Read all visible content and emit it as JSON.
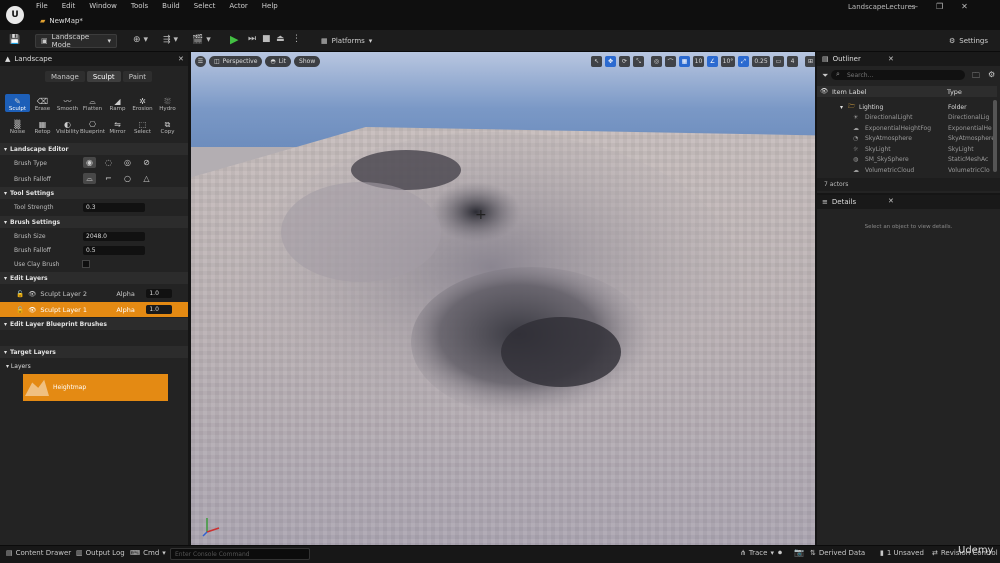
{
  "app": {
    "logo": "U",
    "project_name": "LandscapeLectures",
    "map_tab": "NewMap*"
  },
  "menu": [
    "File",
    "Edit",
    "Window",
    "Tools",
    "Build",
    "Select",
    "Actor",
    "Help"
  ],
  "window_controls": {
    "minimize": "—",
    "maximize": "❐",
    "close": "✕"
  },
  "toolbar": {
    "mode_label": "Landscape Mode",
    "platforms_label": "Platforms",
    "settings_label": "Settings"
  },
  "landscape_panel": {
    "title": "Landscape",
    "modes": [
      "Manage",
      "Sculpt",
      "Paint"
    ],
    "tools_row1": [
      "Sculpt",
      "Erase",
      "Smooth",
      "Flatten",
      "Ramp",
      "Erosion",
      "Hydro"
    ],
    "tools_row2": [
      "Noise",
      "Retop",
      "Visibility",
      "Blueprint",
      "Mirror",
      "Select",
      "Copy"
    ],
    "sections": {
      "landscape_editor": "Landscape Editor",
      "tool_settings": "Tool Settings",
      "brush_settings": "Brush Settings",
      "edit_layers": "Edit Layers",
      "edit_layer_blueprint_brushes": "Edit Layer Blueprint Brushes",
      "target_layers": "Target Layers",
      "layers": "Layers"
    },
    "brush_type_label": "Brush Type",
    "brush_falloff_label": "Brush Falloff",
    "tool_strength_label": "Tool Strength",
    "tool_strength_value": "0.3",
    "brush_size_label": "Brush Size",
    "brush_size_value": "2048.0",
    "brush_falloff_value_label": "Brush Falloff",
    "brush_falloff_value": "0.5",
    "use_clay_brush_label": "Use Clay Brush",
    "edit_layers": [
      {
        "name": "Sculpt Layer 2",
        "alpha_label": "Alpha",
        "alpha": "1.0"
      },
      {
        "name": "Sculpt Layer 1",
        "alpha_label": "Alpha",
        "alpha": "1.0"
      }
    ],
    "heightmap_label": "Heightmap"
  },
  "viewport": {
    "perspective": "Perspective",
    "lit": "Lit",
    "show": "Show",
    "grid_snap": "10",
    "rot_snap": "10°",
    "scale_snap": "0.25",
    "camera_speed": "4"
  },
  "outliner": {
    "title": "Outliner",
    "search_placeholder": "Search...",
    "col_label": "Item Label",
    "col_type": "Type",
    "rows": [
      {
        "name": "Lighting",
        "type": "Folder"
      },
      {
        "name": "DirectionalLight",
        "type": "DirectionalLig"
      },
      {
        "name": "ExponentialHeightFog",
        "type": "ExponentialHe"
      },
      {
        "name": "SkyAtmosphere",
        "type": "SkyAtmosphere"
      },
      {
        "name": "SkyLight",
        "type": "SkyLight"
      },
      {
        "name": "SM_SkySphere",
        "type": "StaticMeshAc"
      },
      {
        "name": "VolumetricCloud",
        "type": "VolumetricClo"
      }
    ],
    "actor_count": "7 actors"
  },
  "details": {
    "title": "Details",
    "empty_message": "Select an object to view details."
  },
  "statusbar": {
    "content_drawer": "Content Drawer",
    "output_log": "Output Log",
    "cmd": "Cmd",
    "console_placeholder": "Enter Console Command",
    "trace": "Trace",
    "derived_data": "Derived Data",
    "unsaved": "1 Unsaved",
    "revision_control": "Revision Control"
  },
  "watermark": "Udemy"
}
